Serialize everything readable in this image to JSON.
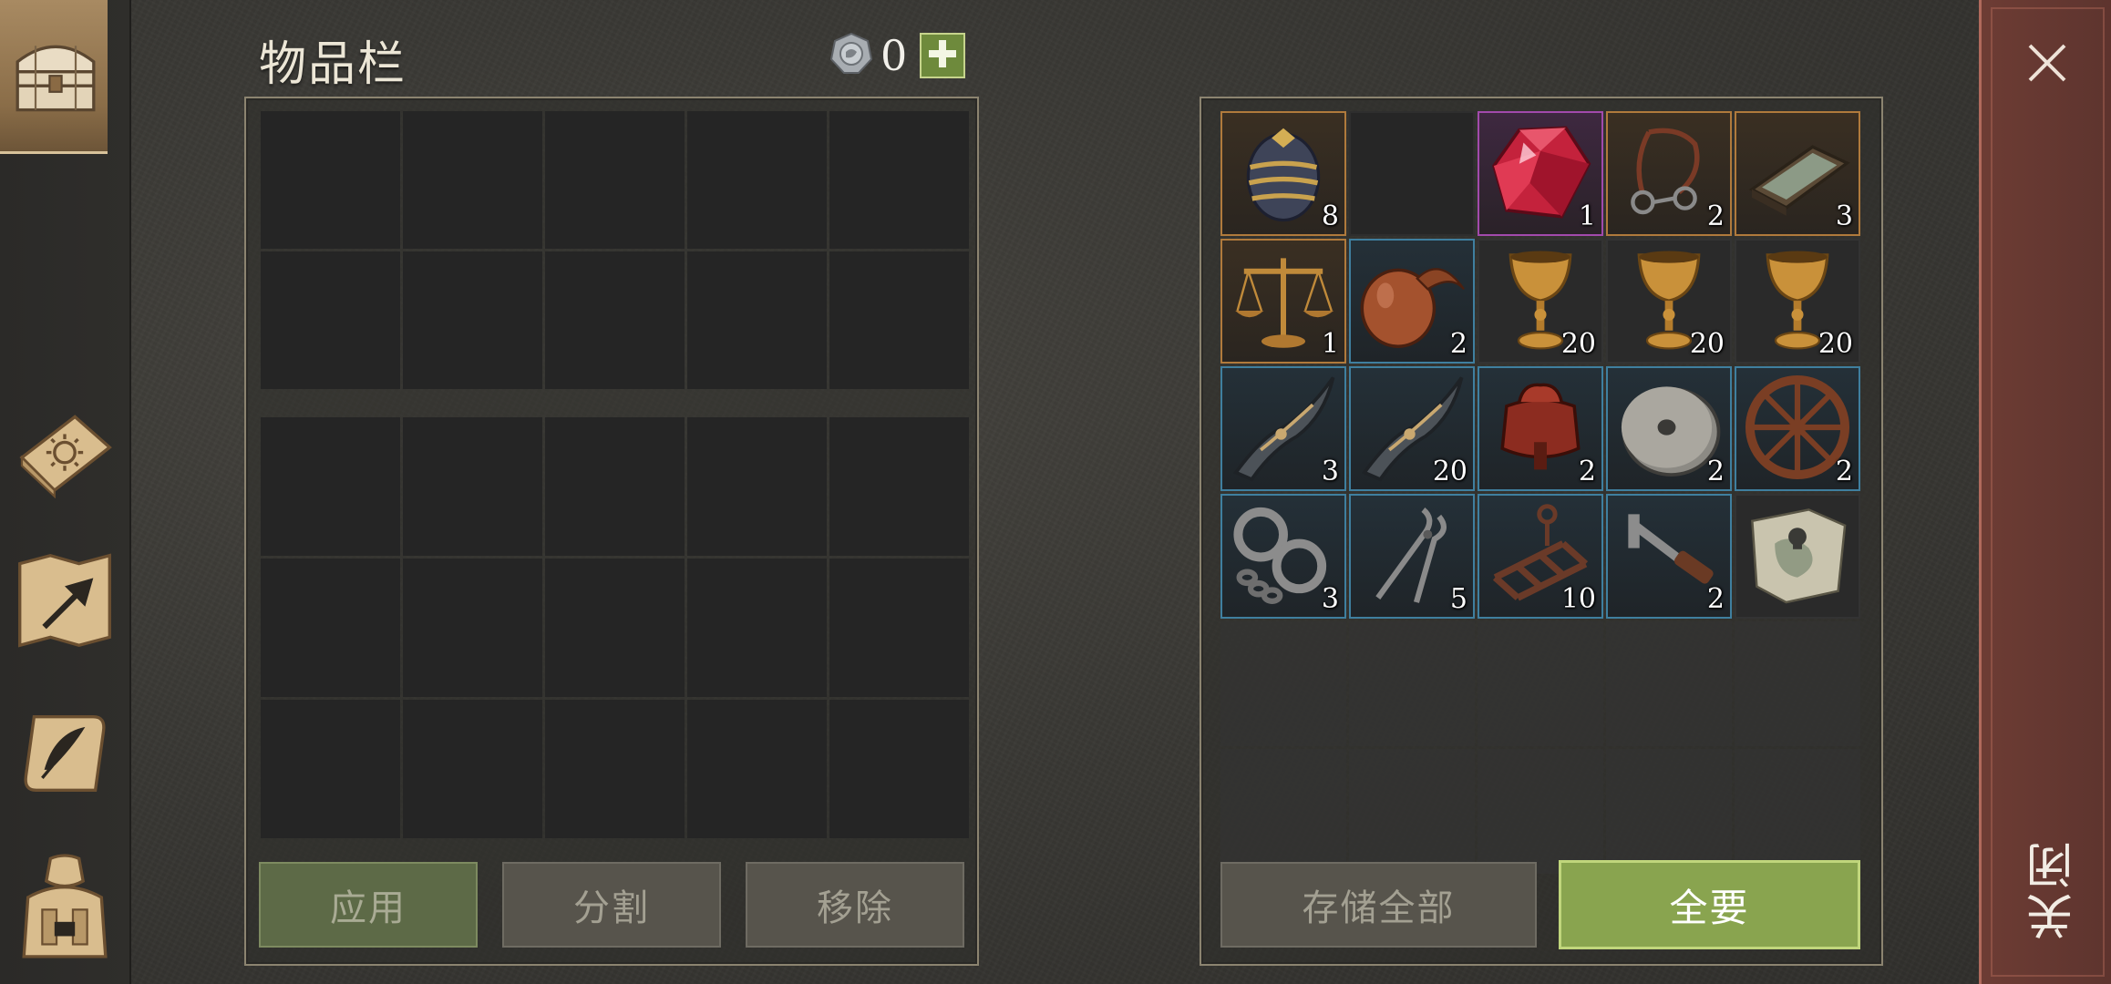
{
  "window": {
    "title": "物品栏",
    "currency_count": "0",
    "close_label": "关闭"
  },
  "sidebar": {
    "items": [
      {
        "icon": "chest-icon",
        "active": true
      },
      {
        "icon": "sun-book-icon",
        "active": false
      },
      {
        "icon": "map-arrow-icon",
        "active": false
      },
      {
        "icon": "scroll-quill-icon",
        "active": false
      },
      {
        "icon": "character-backpack-icon",
        "active": false
      }
    ]
  },
  "left_panel": {
    "buttons": {
      "apply": "应用",
      "split": "分割",
      "remove": "移除"
    }
  },
  "right_panel": {
    "buttons": {
      "store_all": "存储全部",
      "take_all": "全要"
    },
    "items": [
      {
        "name": "egg",
        "qty": "8",
        "rarity": "orange"
      },
      {
        "name": "empty",
        "qty": "",
        "rarity": "none"
      },
      {
        "name": "red-crystal",
        "qty": "1",
        "rarity": "purple"
      },
      {
        "name": "harness",
        "qty": "2",
        "rarity": "orange"
      },
      {
        "name": "tray",
        "qty": "3",
        "rarity": "orange"
      },
      {
        "name": "scales",
        "qty": "1",
        "rarity": "orange"
      },
      {
        "name": "gourd",
        "qty": "2",
        "rarity": "blue"
      },
      {
        "name": "goblet",
        "qty": "20",
        "rarity": "none"
      },
      {
        "name": "goblet",
        "qty": "20",
        "rarity": "none"
      },
      {
        "name": "goblet",
        "qty": "20",
        "rarity": "none"
      },
      {
        "name": "bow-limb",
        "qty": "3",
        "rarity": "blue"
      },
      {
        "name": "bow-limb",
        "qty": "20",
        "rarity": "blue"
      },
      {
        "name": "saddle",
        "qty": "2",
        "rarity": "blue"
      },
      {
        "name": "millstone",
        "qty": "2",
        "rarity": "blue"
      },
      {
        "name": "wheel",
        "qty": "2",
        "rarity": "blue"
      },
      {
        "name": "shackles",
        "qty": "3",
        "rarity": "blue"
      },
      {
        "name": "pliers",
        "qty": "5",
        "rarity": "blue"
      },
      {
        "name": "rack",
        "qty": "10",
        "rarity": "blue"
      },
      {
        "name": "crank",
        "qty": "2",
        "rarity": "blue"
      },
      {
        "name": "treasure-map",
        "qty": "",
        "rarity": "none"
      }
    ]
  },
  "colors": {
    "rarity_orange": "#b07a3c",
    "rarity_purple": "#a24aac",
    "rarity_blue": "#3f7f9f",
    "accent_green": "#89a44f",
    "close_red": "#6d3c34"
  }
}
